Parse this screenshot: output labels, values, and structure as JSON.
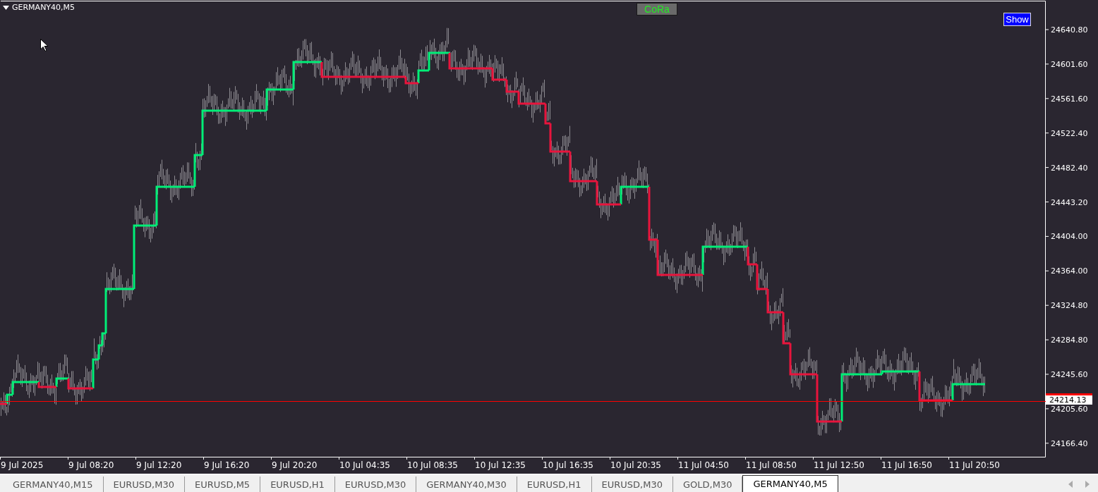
{
  "chart": {
    "title": "GERMANY40,M5",
    "indicator_button": "CoRa",
    "show_button": "Show",
    "price_line": {
      "label": "24214.13"
    },
    "price_axis": [
      "24640.80",
      "24601.60",
      "24561.60",
      "24522.40",
      "24482.40",
      "24443.20",
      "24404.00",
      "24364.00",
      "24324.80",
      "24284.80",
      "24245.60",
      "24205.60",
      "24166.40"
    ],
    "time_axis": [
      "9 Jul 2025",
      "9 Jul 08:20",
      "9 Jul 12:20",
      "9 Jul 16:20",
      "9 Jul 20:20",
      "10 Jul 04:35",
      "10 Jul 08:35",
      "10 Jul 12:35",
      "10 Jul 16:35",
      "10 Jul 20:35",
      "11 Jul 04:50",
      "11 Jul 08:50",
      "11 Jul 12:50",
      "11 Jul 16:50",
      "11 Jul 20:50"
    ]
  },
  "tabs": [
    {
      "label": "GERMANY40,M15",
      "selected": false
    },
    {
      "label": "EURUSD,M30",
      "selected": false
    },
    {
      "label": "EURUSD,M5",
      "selected": false
    },
    {
      "label": "EURUSD,H1",
      "selected": false
    },
    {
      "label": "EURUSD,M30",
      "selected": false
    },
    {
      "label": "GERMANY40,M30",
      "selected": false
    },
    {
      "label": "EURUSD,H1",
      "selected": false
    },
    {
      "label": "EURUSD,M30",
      "selected": false
    },
    {
      "label": "GOLD,M30",
      "selected": false
    },
    {
      "label": "GERMANY40,M5",
      "selected": true
    }
  ]
}
